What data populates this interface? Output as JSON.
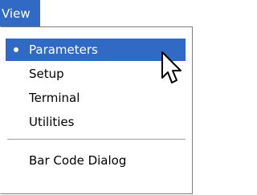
{
  "menubar": {
    "view_label": "View"
  },
  "menu": {
    "items": [
      {
        "label": "Parameters",
        "selected": true,
        "checked": true
      },
      {
        "label": "Setup",
        "selected": false,
        "checked": false
      },
      {
        "label": "Terminal",
        "selected": false,
        "checked": false
      },
      {
        "label": "Utilities",
        "selected": false,
        "checked": false
      },
      {
        "label": "Bar Code Dialog",
        "selected": false,
        "checked": false
      }
    ]
  },
  "colors": {
    "highlight": "#316ac5",
    "highlight_text": "#ffffff",
    "menu_bg": "#ffffff",
    "separator": "#a0a0a0"
  },
  "icons": {
    "checked_bullet": "radio-bullet-icon",
    "cursor": "mouse-pointer-icon"
  }
}
